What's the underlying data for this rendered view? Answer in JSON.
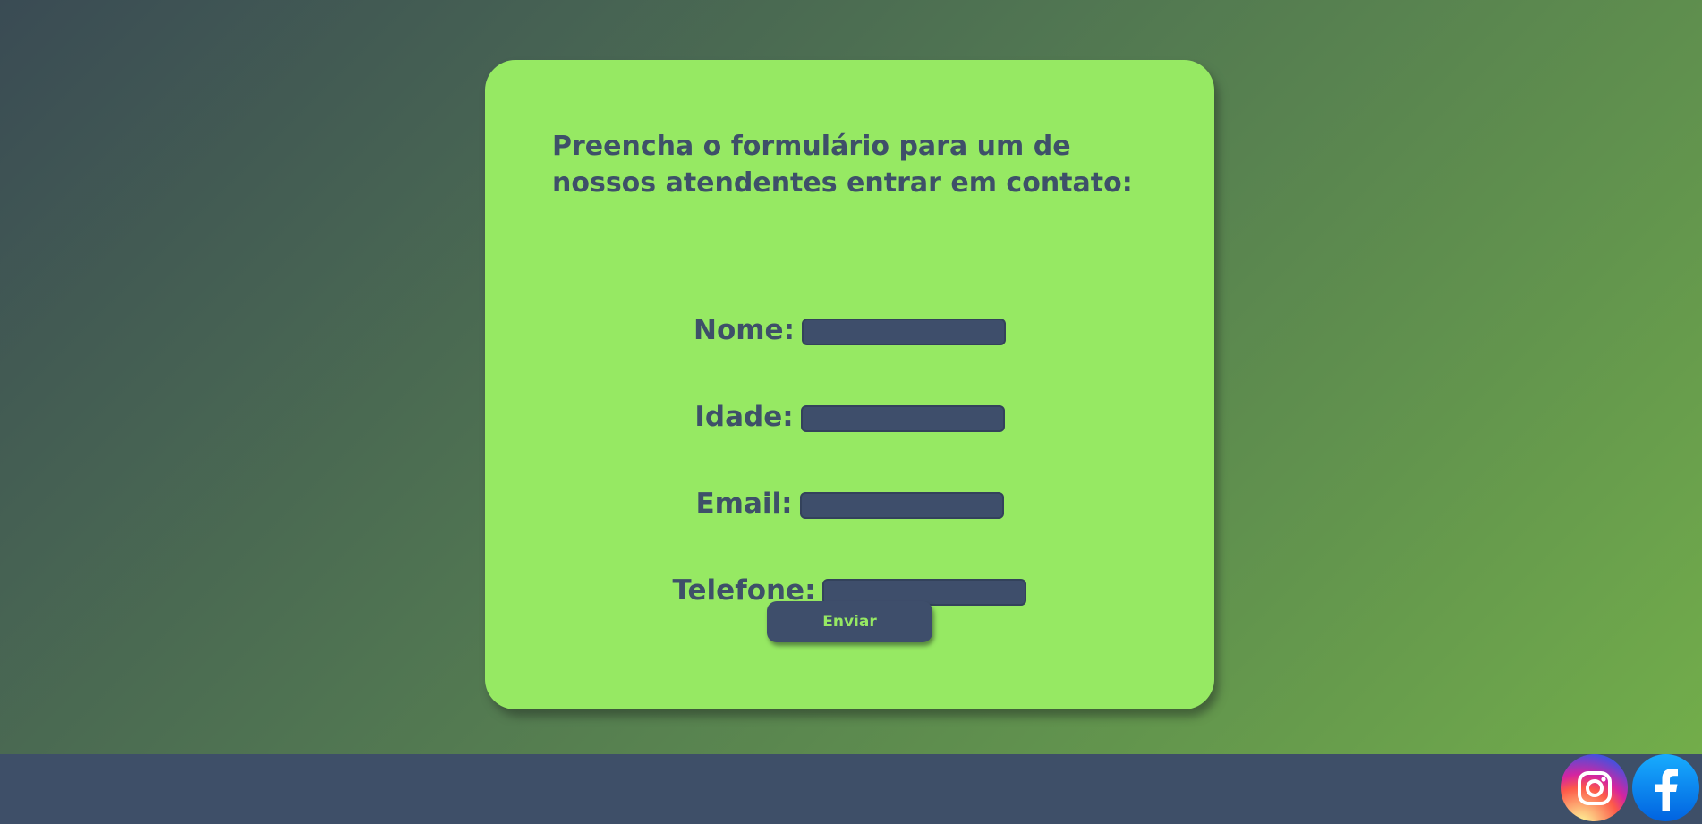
{
  "form": {
    "heading": "Preencha o formulário para um de nossos atendentes entrar em contato:",
    "fields": [
      {
        "label": "Nome:",
        "value": ""
      },
      {
        "label": "Idade:",
        "value": ""
      },
      {
        "label": "Email:",
        "value": ""
      },
      {
        "label": "Telefone:",
        "value": ""
      }
    ],
    "submit_label": "Enviar"
  },
  "footer": {
    "social": [
      {
        "name": "instagram",
        "icon": "instagram-icon"
      },
      {
        "name": "facebook",
        "icon": "facebook-icon"
      }
    ]
  },
  "colors": {
    "card_background": "#96e963",
    "text_primary": "#3e5069",
    "input_background": "#3e4e6b",
    "button_text": "#96e963",
    "footer_background": "#3e4f68",
    "facebook_blue": "#1877f2"
  }
}
